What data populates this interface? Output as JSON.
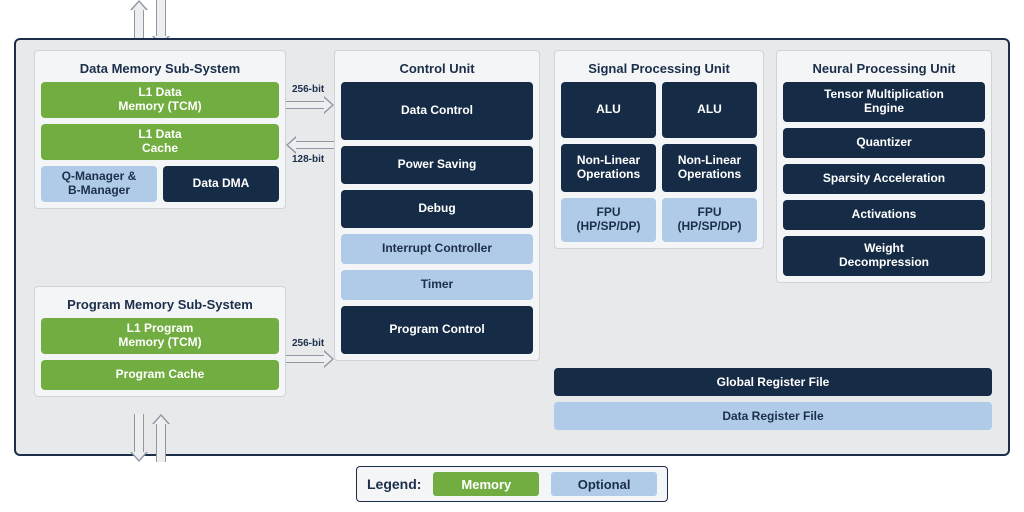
{
  "legend": {
    "label": "Legend:",
    "memory": "Memory",
    "optional": "Optional"
  },
  "bus": {
    "w256": "256-bit",
    "w128": "128-bit"
  },
  "data_mem": {
    "title": "Data Memory Sub-System",
    "l1_tcm_a": "L1 Data",
    "l1_tcm_b": "Memory (TCM)",
    "l1_cache_a": "L1 Data",
    "l1_cache_b": "Cache",
    "qmgr_a": "Q-Manager &",
    "qmgr_b": "B-Manager",
    "dma": "Data DMA"
  },
  "prog_mem": {
    "title": "Program Memory Sub-System",
    "l1_tcm_a": "L1 Program",
    "l1_tcm_b": "Memory (TCM)",
    "cache": "Program Cache"
  },
  "control": {
    "title": "Control Unit",
    "data_ctrl": "Data Control",
    "power": "Power Saving",
    "debug": "Debug",
    "irq": "Interrupt Controller",
    "timer": "Timer",
    "prog_ctrl": "Program Control"
  },
  "spu": {
    "title": "Signal Processing Unit",
    "alu": "ALU",
    "nlo_a": "Non-Linear",
    "nlo_b": "Operations",
    "fpu_a": "FPU",
    "fpu_b": "(HP/SP/DP)"
  },
  "npu": {
    "title": "Neural Processing Unit",
    "tmul_a": "Tensor Multiplication",
    "tmul_b": "Engine",
    "quant": "Quantizer",
    "spars": "Sparsity Acceleration",
    "act": "Activations",
    "wdec_a": "Weight",
    "wdec_b": "Decompression"
  },
  "regs": {
    "global": "Global Register File",
    "data": "Data Register File"
  }
}
